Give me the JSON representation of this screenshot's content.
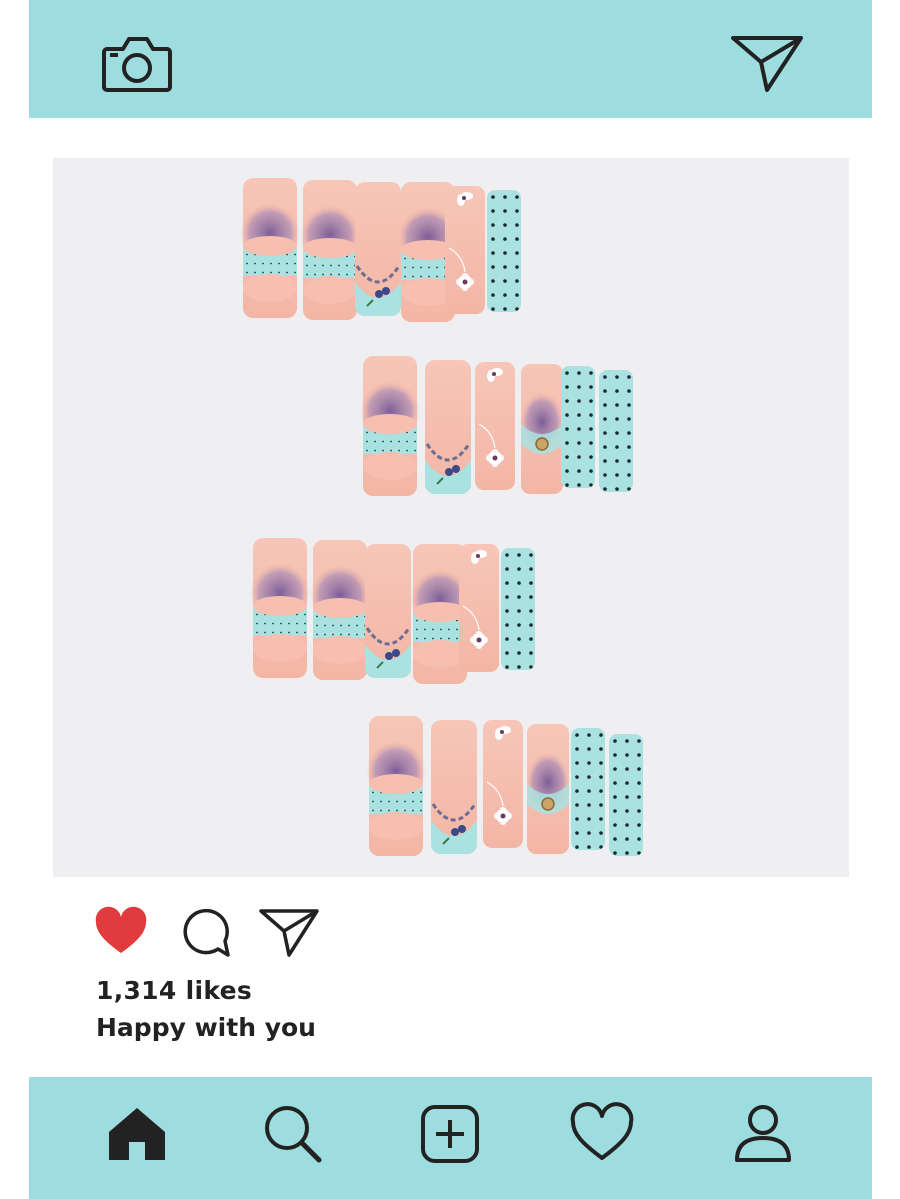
{
  "colors": {
    "bar_bg": "#9ddcdf",
    "heart_red": "#e23b3e",
    "icon_stroke": "#222222",
    "nail_pink": "#f6c3b4",
    "nail_blue": "#a9e2e1",
    "nail_purple": "#8a6fa0"
  },
  "top_bar": {
    "left_icon": "camera-icon",
    "right_icon": "send-icon"
  },
  "post": {
    "image_alt": "press-on nails with purple ombre, blue polka dots and white flowers",
    "likes": "1,314 likes",
    "caption": "Happy with you",
    "action_icons": [
      "heart-icon",
      "comment-icon",
      "share-icon"
    ]
  },
  "bottom_nav": {
    "items": [
      "home-icon",
      "search-icon",
      "add-icon",
      "activity-heart-icon",
      "profile-icon"
    ]
  }
}
